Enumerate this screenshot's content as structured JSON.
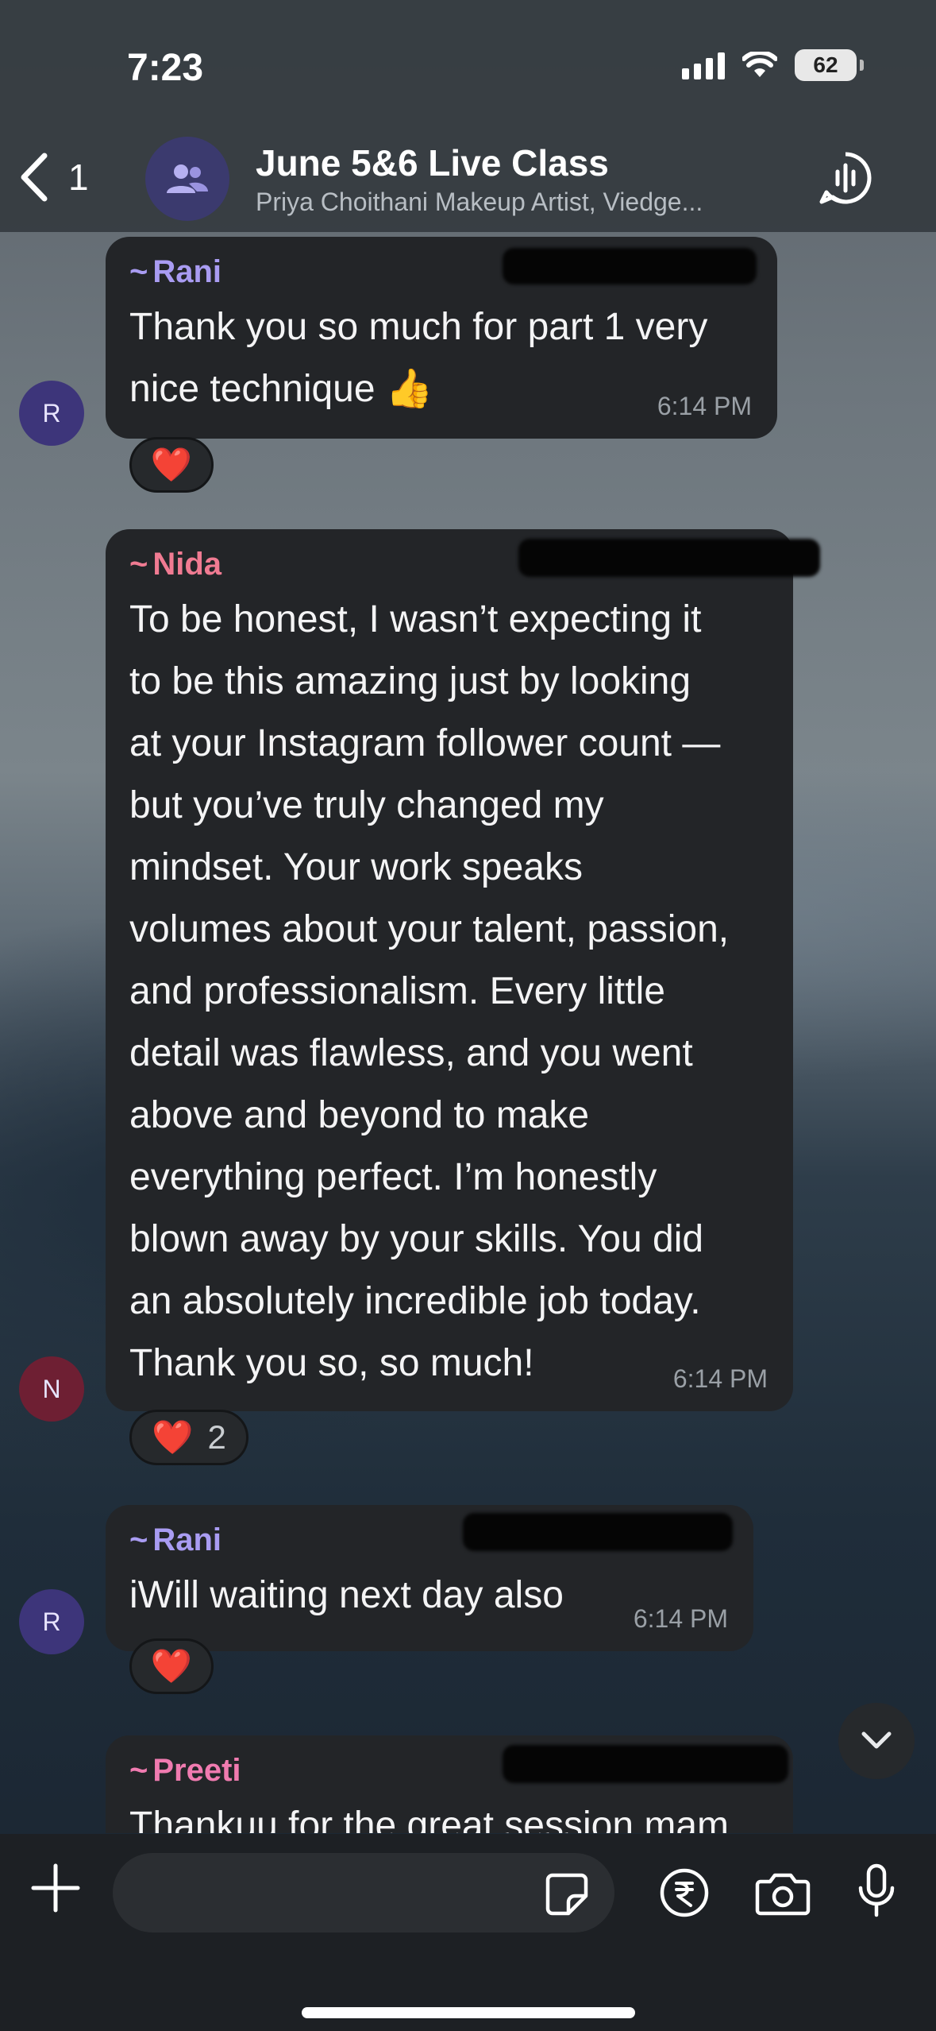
{
  "status_bar": {
    "time": "7:23",
    "battery": "62"
  },
  "header": {
    "back_count": "1",
    "title": "June 5&6 Live Class",
    "subtitle": "Priya Choithani Makeup Artist, Viedge..."
  },
  "messages": [
    {
      "sender": "Rani",
      "sender_color": "#a99cf2",
      "avatar_letter": "R",
      "avatar_color": "#3d357a",
      "lines": [
        "Thank you so much for part 1 very",
        "nice technique 👍"
      ],
      "time": "6:14 PM",
      "reaction_emoji": "❤️",
      "reaction_count": ""
    },
    {
      "sender": "Nida",
      "sender_color": "#f07b92",
      "avatar_letter": "N",
      "avatar_color": "#6e1f33",
      "lines": [
        "To be honest, I wasn’t expecting it",
        "to be this amazing just by looking",
        "at your Instagram follower count —",
        "but you’ve truly changed my",
        "mindset. Your work speaks",
        "volumes about your talent, passion,",
        "and professionalism. Every little",
        "detail was flawless, and you went",
        "above and beyond to make",
        "everything perfect. I’m honestly",
        "blown away by your skills. You did",
        "an absolutely incredible job today.",
        "Thank you so, so much!"
      ],
      "time": "6:14 PM",
      "reaction_emoji": "❤️",
      "reaction_count": "2"
    },
    {
      "sender": "Rani",
      "sender_color": "#a99cf2",
      "avatar_letter": "R",
      "avatar_color": "#3d357a",
      "lines": [
        "iWill waiting next day also"
      ],
      "time": "6:14 PM",
      "reaction_emoji": "❤️",
      "reaction_count": ""
    },
    {
      "sender": "Preeti",
      "sender_color": "#f07bb0",
      "lines": [
        "Thankuu for the great session mam"
      ]
    }
  ],
  "icons": {
    "back": "chevron-left-icon",
    "group": "group-people-icon",
    "voice": "voice-chat-icon",
    "scroll": "chevron-down-icon",
    "plus": "plus-icon",
    "sticker": "sticker-icon",
    "payment": "rupee-icon",
    "camera": "camera-icon",
    "mic": "microphone-icon"
  }
}
